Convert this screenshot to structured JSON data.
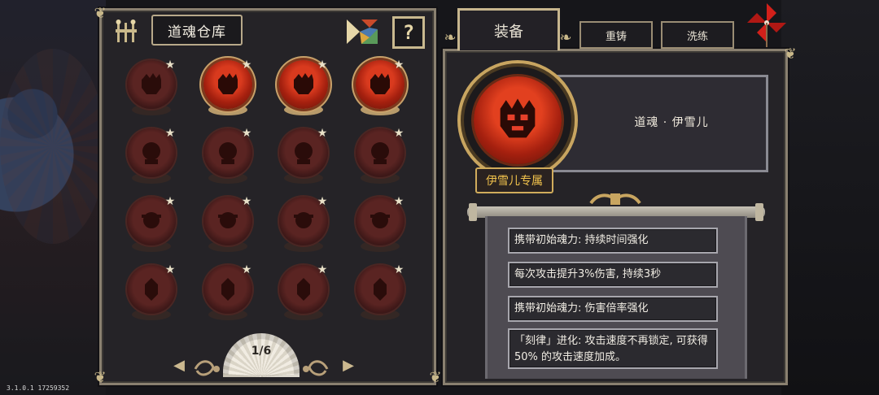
{
  "version": "3.1.0.1 17259352",
  "storage": {
    "title": "道魂仓库",
    "help_label": "?",
    "page": "1/6",
    "prev_arrow": "◀",
    "next_arrow": "▶",
    "slots": [
      {
        "active": false,
        "star": "★"
      },
      {
        "active": true,
        "star": "★"
      },
      {
        "active": true,
        "star": "★"
      },
      {
        "active": true,
        "star": "★"
      },
      {
        "active": false,
        "star": "★"
      },
      {
        "active": false,
        "star": "★"
      },
      {
        "active": false,
        "star": "★"
      },
      {
        "active": false,
        "star": "★"
      },
      {
        "active": false,
        "star": "★"
      },
      {
        "active": false,
        "star": "★"
      },
      {
        "active": false,
        "star": "★"
      },
      {
        "active": false,
        "star": "★"
      },
      {
        "active": false,
        "star": "★"
      },
      {
        "active": false,
        "star": "★"
      },
      {
        "active": false,
        "star": "★"
      },
      {
        "active": false,
        "star": "★"
      }
    ]
  },
  "tabs": {
    "equip": "装备",
    "reforge": "重铸",
    "wash": "洗练"
  },
  "detail": {
    "soul_name": "道魂 · 伊雪儿",
    "exclusive_tag": "伊雪儿专属",
    "effects": [
      "携带初始魂力: 持续时间强化",
      "每次攻击提升3%伤害, 持续3秒",
      "携带初始魂力: 伤害倍率强化",
      "「刻律」进化: 攻击速度不再锁定, 可获得 50% 的攻击速度加成。"
    ]
  },
  "colors": {
    "accent_gold": "#c8a560",
    "orb_red": "#d93a1e",
    "tag_text": "#f2c34c"
  }
}
